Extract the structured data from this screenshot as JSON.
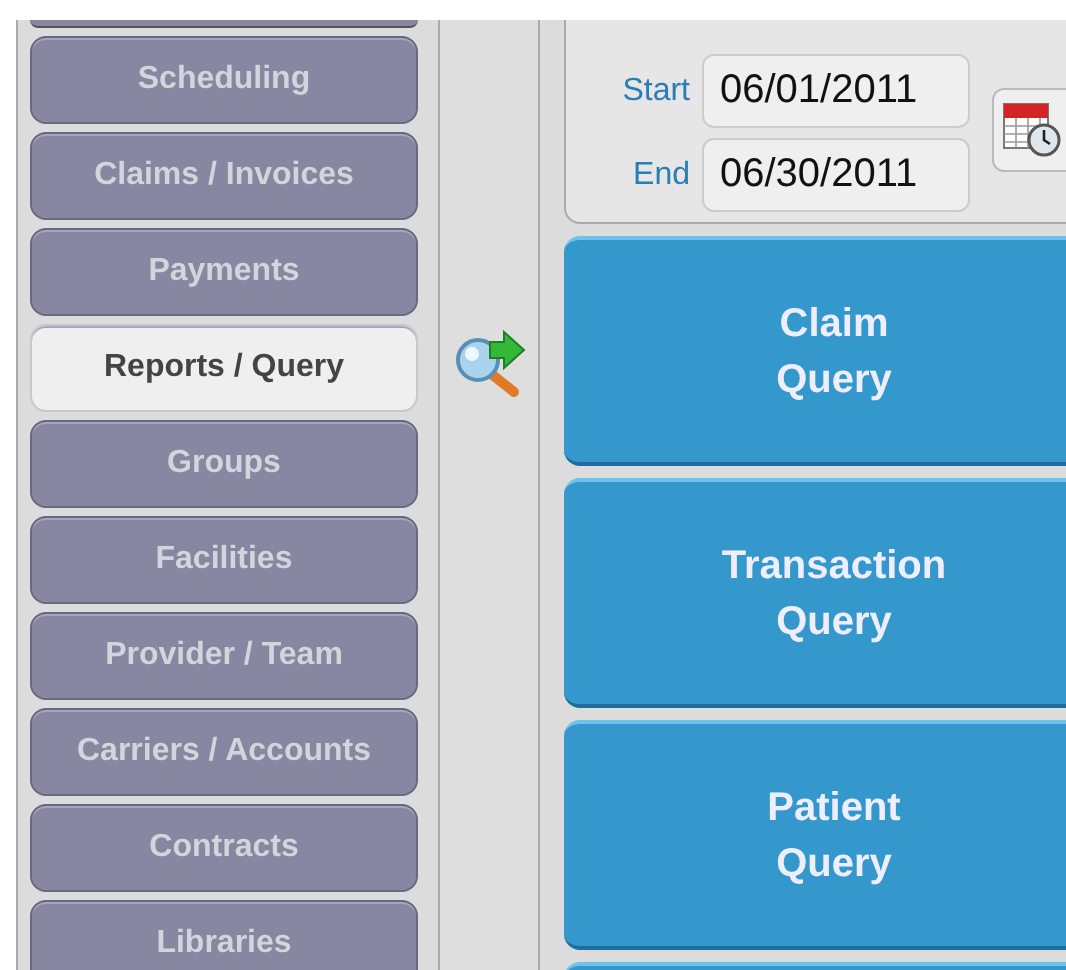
{
  "sidebar": {
    "items": [
      {
        "label": "Scheduling",
        "selected": false
      },
      {
        "label": "Claims / Invoices",
        "selected": false
      },
      {
        "label": "Payments",
        "selected": false
      },
      {
        "label": "Reports / Query",
        "selected": true
      },
      {
        "label": "Groups",
        "selected": false
      },
      {
        "label": "Facilities",
        "selected": false
      },
      {
        "label": "Provider / Team",
        "selected": false
      },
      {
        "label": "Carriers / Accounts",
        "selected": false
      },
      {
        "label": "Contracts",
        "selected": false
      },
      {
        "label": "Libraries",
        "selected": false
      }
    ]
  },
  "date_range": {
    "start_label": "Start",
    "start_value": "06/01/2011",
    "end_label": "End",
    "end_value": "06/30/2011"
  },
  "query_buttons": [
    [
      "Claim",
      "Query"
    ],
    [
      "Transaction",
      "Query"
    ],
    [
      "Patient",
      "Query"
    ]
  ]
}
